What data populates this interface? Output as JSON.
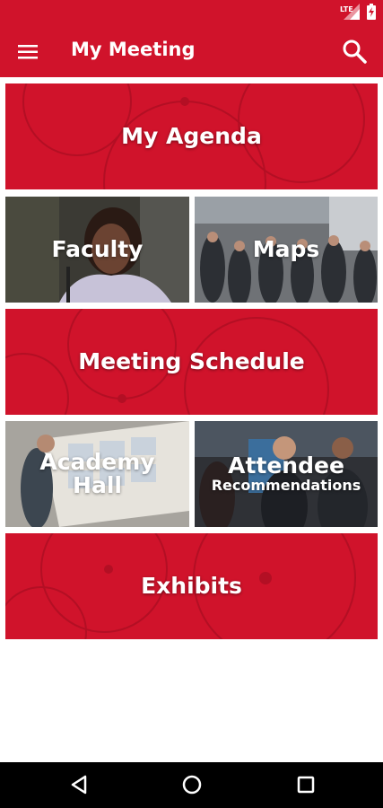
{
  "status_bar": {
    "network_label": "LTE"
  },
  "app_bar": {
    "title": "My Meeting"
  },
  "tiles": [
    {
      "label": "My Agenda"
    },
    {
      "label": "Faculty"
    },
    {
      "label": "Maps"
    },
    {
      "label": "Meeting Schedule"
    },
    {
      "label": "Academy",
      "label2": "Hall"
    },
    {
      "label": "Attendee",
      "label2": "Recommendations"
    },
    {
      "label": "Exhibits"
    }
  ],
  "colors": {
    "brand_red": "#d0132b",
    "nav_bar": "#000000"
  },
  "icons": {
    "menu": "menu-icon",
    "search": "search-icon",
    "back": "back-icon",
    "home": "home-icon",
    "recents": "recents-icon"
  }
}
